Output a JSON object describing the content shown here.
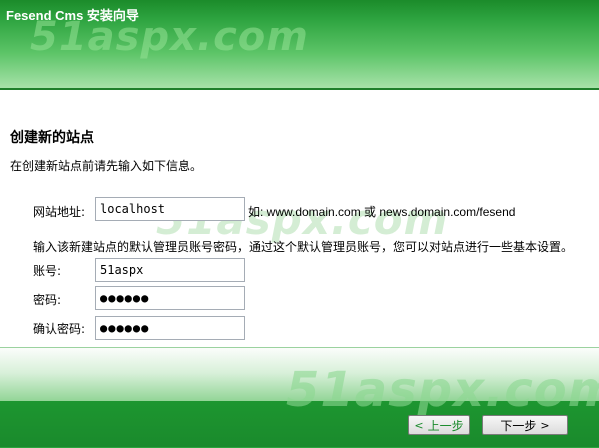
{
  "window": {
    "title": "Fesend Cms 安装向导"
  },
  "watermark": {
    "text": "51aspx.com"
  },
  "section": {
    "title": "创建新的站点",
    "intro": "在创建新站点前请先输入如下信息。"
  },
  "site": {
    "label": "网站地址:",
    "value": "localhost",
    "hint": "如: www.domain.com 或  news.domain.com/fesend"
  },
  "admin": {
    "intro": "输入该新建站点的默认管理员账号密码，通过这个默认管理员账号，您可以对站点进行一些基本设置。",
    "account_label": "账号:",
    "account_value": "51aspx",
    "password_label": "密码:",
    "password_value": "●●●●●●",
    "confirm_label": "确认密码:",
    "confirm_value": "●●●●●●"
  },
  "buttons": {
    "prev_label": "上一步",
    "prev_arrow": "<",
    "next_label": "下一步",
    "next_arrow": ">"
  },
  "colors": {
    "header_green": "#2ea440",
    "footer_green": "#1a8a2c",
    "watermark_green": "#96e196"
  }
}
